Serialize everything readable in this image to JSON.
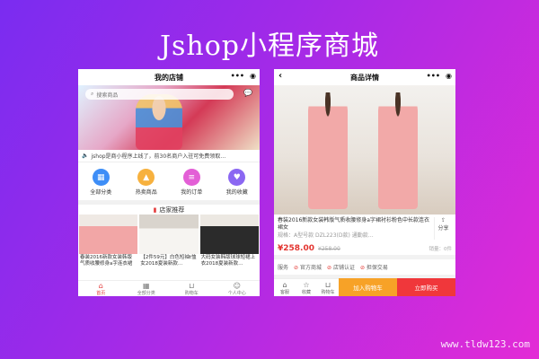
{
  "page_title": "Jshop小程序商城",
  "watermark": "www.tldw123.com",
  "store_phone": {
    "header_title": "我的店铺",
    "header_icons": [
      "more-dots-icon",
      "target-icon"
    ],
    "search_placeholder": "搜索商品",
    "notice_text": "jshop是商小程序上线了，前30名商户入驻可免费领取…",
    "menu": [
      {
        "label": "全部分类",
        "icon": "grid-icon",
        "color": "#3e8ef7"
      },
      {
        "label": "热卖商品",
        "icon": "fire-icon",
        "color": "#f7b13e"
      },
      {
        "label": "我的订单",
        "icon": "order-icon",
        "color": "#e35fd6"
      },
      {
        "label": "我的收藏",
        "icon": "favorite-icon",
        "color": "#8b67f2"
      }
    ],
    "section_title": "店家推荐",
    "goods": [
      {
        "name": "春装2016新款女装韩版气质收腰修身a字连衣裙"
      },
      {
        "name": "【2件59元】白色短袖t恤女2018夏装新款…"
      },
      {
        "name": "大码女装韩版球球短裙上衣2018夏装新款…"
      }
    ],
    "tabs": [
      {
        "label": "首页",
        "icon": "home-icon",
        "active": true
      },
      {
        "label": "全部分类",
        "icon": "category-icon",
        "active": false
      },
      {
        "label": "购物车",
        "icon": "cart-icon",
        "active": false
      },
      {
        "label": "个人中心",
        "icon": "user-icon",
        "active": false
      }
    ]
  },
  "detail_phone": {
    "back_icon": "‹",
    "header_title": "商品详情",
    "product_title": "春装2016新款女装韩版气质收腰修身a字裙衬衫粉色中长款连衣裙女",
    "product_sub": "规格：A型号款  DZL223(D款)  通勤款…",
    "share_label": "分享",
    "price": "¥258.00",
    "old_price": "¥258.00",
    "sold": "销量：0件",
    "services_label": "服务",
    "services": [
      "官方商城",
      "店铺认证",
      "担保交易"
    ],
    "bottom": [
      {
        "label": "客服",
        "icon": "service-icon"
      },
      {
        "label": "收藏",
        "icon": "star-icon"
      },
      {
        "label": "购物车",
        "icon": "cart-icon"
      }
    ],
    "add_cart": "加入购物车",
    "buy_now": "立即购买"
  }
}
